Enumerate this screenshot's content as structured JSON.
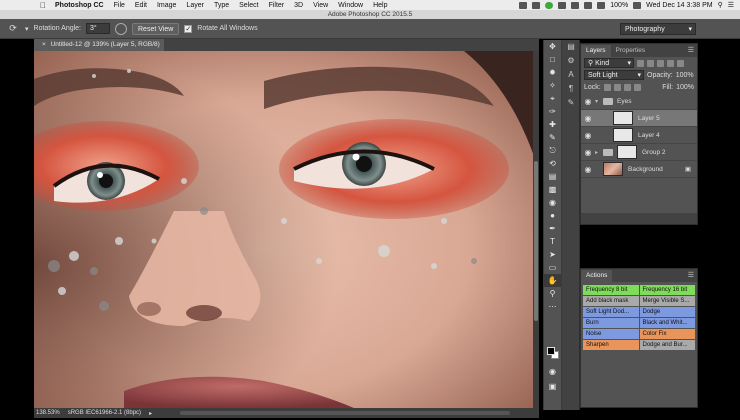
{
  "menubar": {
    "app": "Photoshop CC",
    "items": [
      "File",
      "Edit",
      "Image",
      "Layer",
      "Type",
      "Select",
      "Filter",
      "3D",
      "View",
      "Window",
      "Help"
    ],
    "battery": "100%",
    "clock": "Wed Dec 14  3:38 PM"
  },
  "app_title": "Adobe Photoshop CC 2015.5",
  "options": {
    "rotation_label": "Rotation Angle:",
    "rotation_value": "3°",
    "reset_view": "Reset View",
    "rotate_all": "Rotate All Windows",
    "workspace": "Photography"
  },
  "document": {
    "tab_title": "Untitled-12 @ 139% (Layer 5, RGB/8)",
    "zoom": "138.53%",
    "profile": "sRGB IEC61966-2.1 (8bpc)"
  },
  "layers_panel": {
    "tabs": [
      "Layers",
      "Properties"
    ],
    "filter": "Kind",
    "blend_mode": "Soft Light",
    "opacity_label": "Opacity:",
    "opacity": "100%",
    "lock_label": "Lock:",
    "fill_label": "Fill:",
    "fill": "100%",
    "layers": [
      {
        "name": "Eyes",
        "type": "group",
        "selected": false
      },
      {
        "name": "Layer 5",
        "type": "layer",
        "selected": true
      },
      {
        "name": "Layer 4",
        "type": "layer",
        "selected": false
      },
      {
        "name": "Group 2",
        "type": "group",
        "selected": false
      },
      {
        "name": "Background",
        "type": "photo",
        "selected": false
      }
    ]
  },
  "actions_panel": {
    "title": "Actions",
    "buttons": [
      {
        "label": "Frequency 8 bit",
        "color": "#7fdc5a"
      },
      {
        "label": "Frequency 16 bit",
        "color": "#7fdc5a"
      },
      {
        "label": "Add black mask",
        "color": "#a9a9a9"
      },
      {
        "label": "Merge Visible S...",
        "color": "#a9a9a9"
      },
      {
        "label": "Soft Light Dod...",
        "color": "#7d9ae0"
      },
      {
        "label": "Dodge",
        "color": "#7d9ae0"
      },
      {
        "label": "Burn",
        "color": "#7d9ae0"
      },
      {
        "label": "Black and Whit...",
        "color": "#7d9ae0"
      },
      {
        "label": "Noise",
        "color": "#7d9ae0"
      },
      {
        "label": "Color Fix",
        "color": "#e8945a"
      },
      {
        "label": "Sharpen",
        "color": "#e8945a"
      },
      {
        "label": "Dodge and Bur...",
        "color": "#a9a9a9"
      }
    ]
  }
}
